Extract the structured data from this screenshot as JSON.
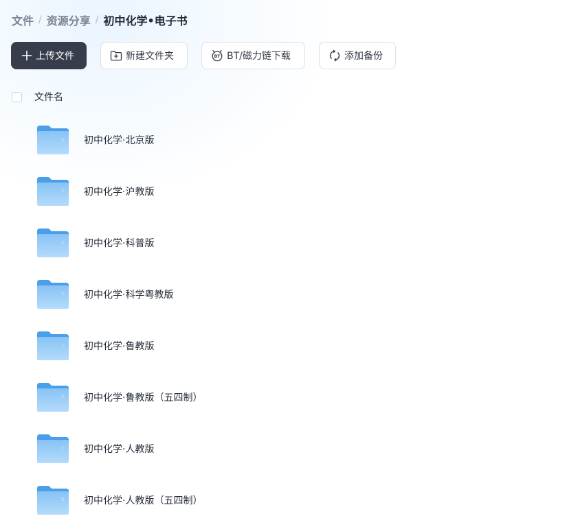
{
  "breadcrumb": {
    "items": [
      "文件",
      "资源分享"
    ],
    "separator": "/",
    "current": "初中化学•电子书"
  },
  "toolbar": {
    "upload_label": "上传文件",
    "new_folder_label": "新建文件夹",
    "bt_download_label": "BT/磁力链下载",
    "add_backup_label": "添加备份"
  },
  "list": {
    "column_name": "文件名",
    "files": [
      {
        "name": "初中化学·北京版",
        "icon": "folder-icon"
      },
      {
        "name": "初中化学·沪教版",
        "icon": "folder-icon"
      },
      {
        "name": "初中化学·科普版",
        "icon": "folder-icon"
      },
      {
        "name": "初中化学·科学粤教版",
        "icon": "folder-icon"
      },
      {
        "name": "初中化学·鲁教版",
        "icon": "folder-icon"
      },
      {
        "name": "初中化学·鲁教版（五四制）",
        "icon": "folder-icon"
      },
      {
        "name": "初中化学·人教版",
        "icon": "folder-icon"
      },
      {
        "name": "初中化学·人教版（五四制）",
        "icon": "folder-icon"
      }
    ]
  },
  "colors": {
    "primary_button": "#383d4d",
    "folder_blue": "#8ec8f6",
    "text": "#252b38"
  }
}
